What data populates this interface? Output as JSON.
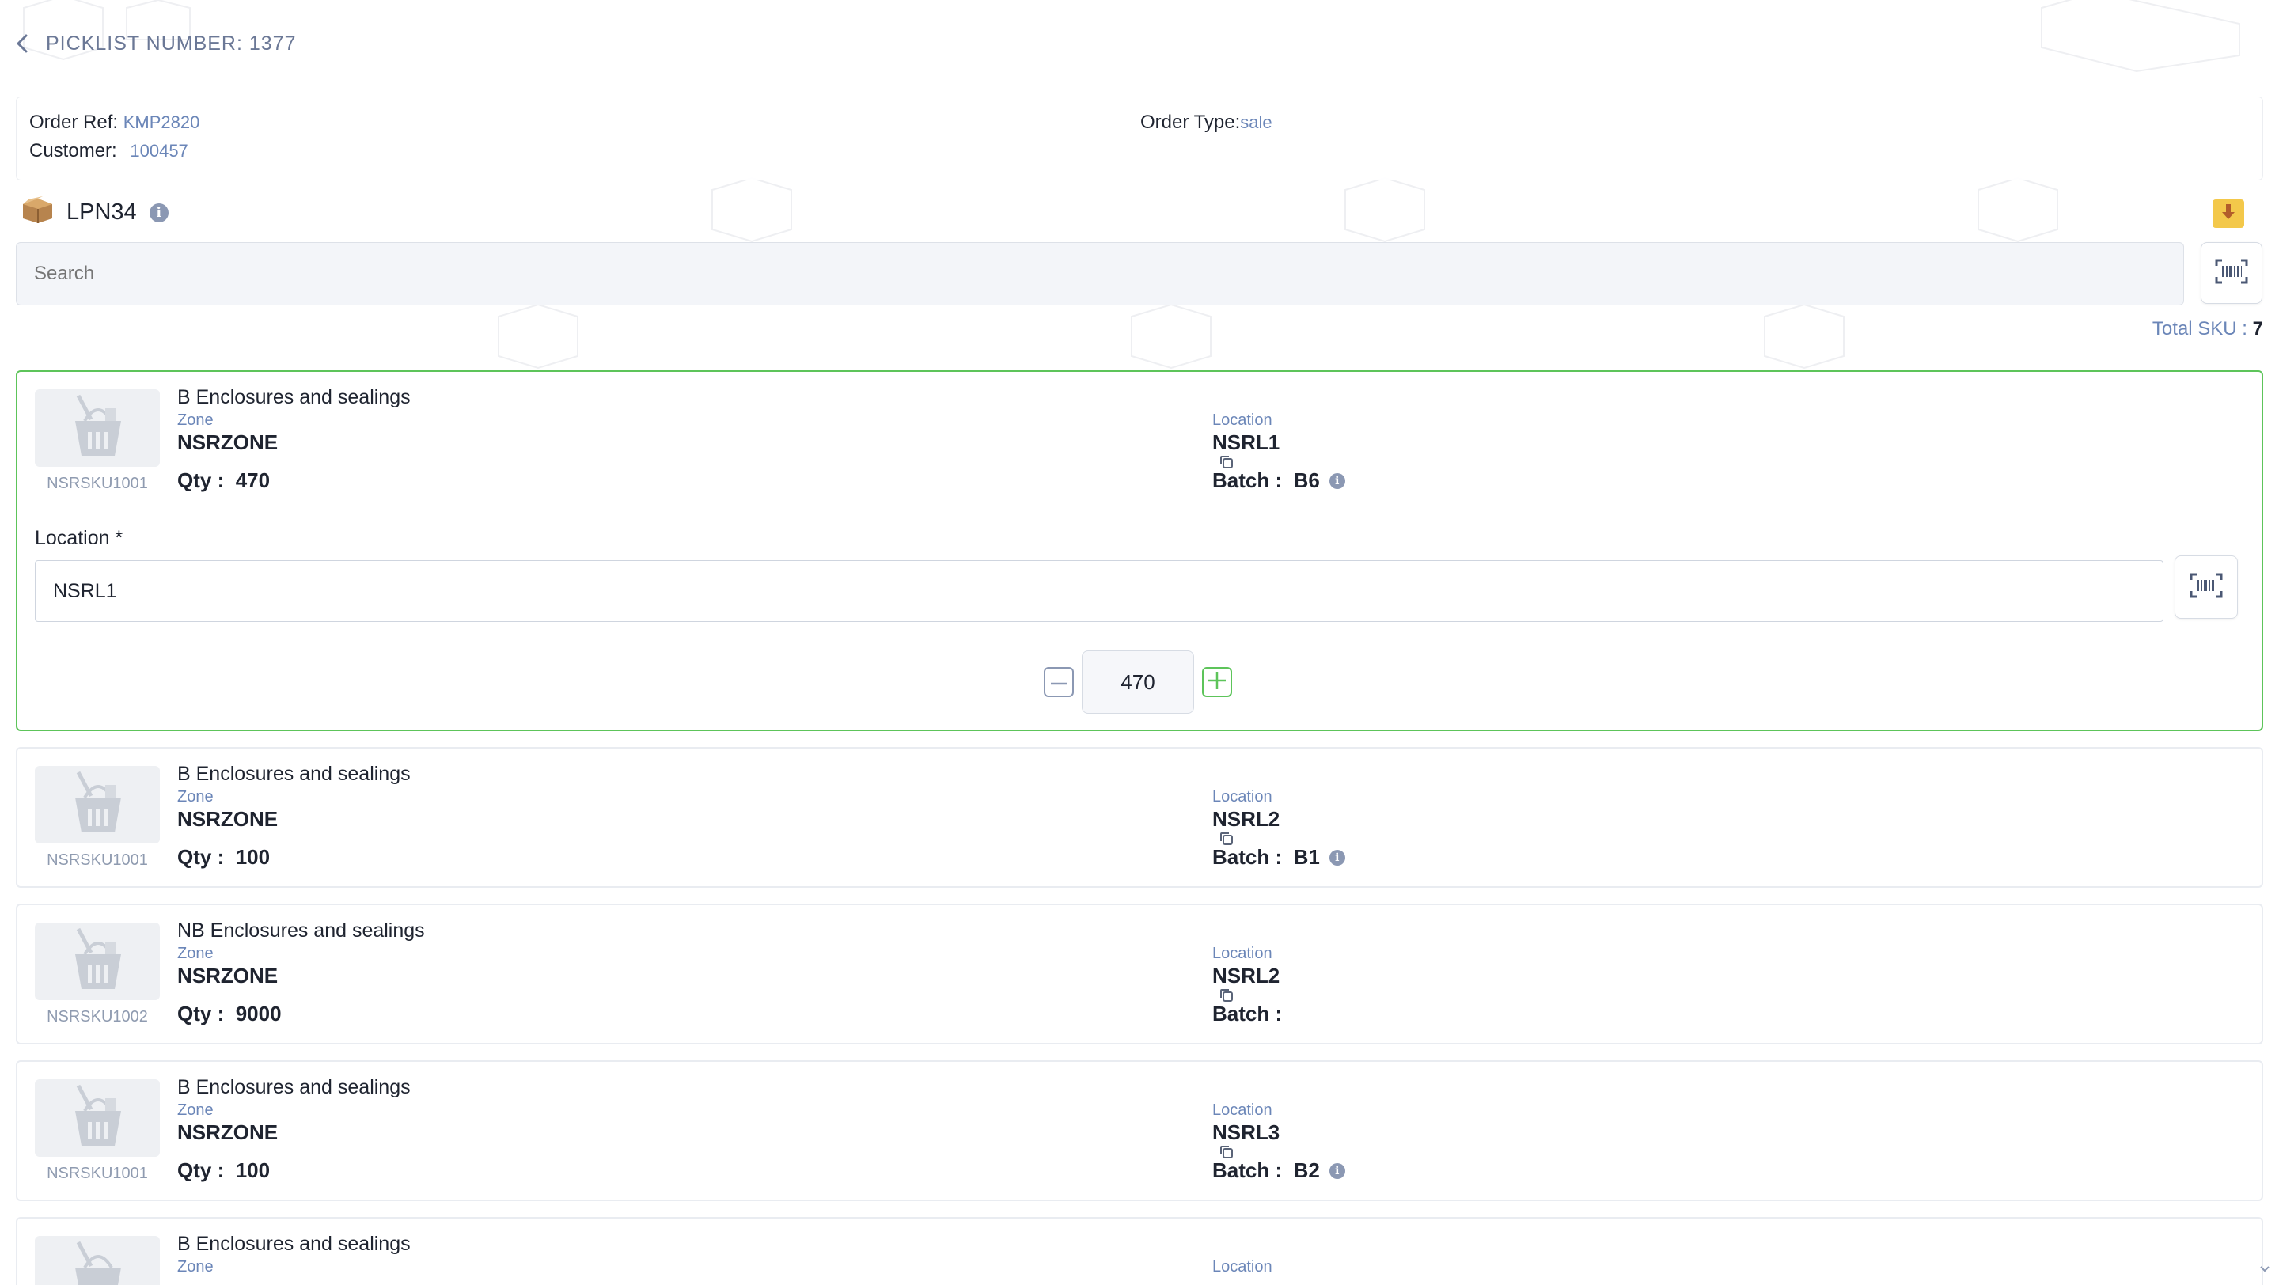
{
  "header": {
    "title": "PICKLIST NUMBER: 1377"
  },
  "order": {
    "ref_label": "Order Ref:",
    "ref_value": "KMP2820",
    "customer_label": "Customer:",
    "customer_value": "100457",
    "type_label": "Order Type:",
    "type_value": "sale"
  },
  "lpn": {
    "label": "LPN34"
  },
  "search": {
    "placeholder": "Search"
  },
  "total": {
    "label": "Total SKU :",
    "value": "7"
  },
  "labels": {
    "zone": "Zone",
    "location": "Location",
    "qty": "Qty :",
    "batch": "Batch :",
    "location_field": "Location *"
  },
  "items": [
    {
      "name": "B Enclosures and sealings",
      "sku": "NSRSKU1001",
      "zone": "NSRZONE",
      "location": "NSRL1",
      "qty": "470",
      "batch": "B6"
    },
    {
      "name": "B Enclosures and sealings",
      "sku": "NSRSKU1001",
      "zone": "NSRZONE",
      "location": "NSRL2",
      "qty": "100",
      "batch": "B1"
    },
    {
      "name": "NB Enclosures and sealings",
      "sku": "NSRSKU1002",
      "zone": "NSRZONE",
      "location": "NSRL2",
      "qty": "9000",
      "batch": ""
    },
    {
      "name": "B Enclosures and sealings",
      "sku": "NSRSKU1001",
      "zone": "NSRZONE",
      "location": "NSRL3",
      "qty": "100",
      "batch": "B2"
    },
    {
      "name": "B Enclosures and sealings",
      "zone": "Zone",
      "location": "Location"
    }
  ],
  "active_item": {
    "location_value": "NSRL1",
    "quantity_value": "470"
  },
  "colors": {
    "accent_green": "#5dc45a",
    "link_blue": "#6b86b8",
    "download_yellow": "#f3c84a"
  }
}
